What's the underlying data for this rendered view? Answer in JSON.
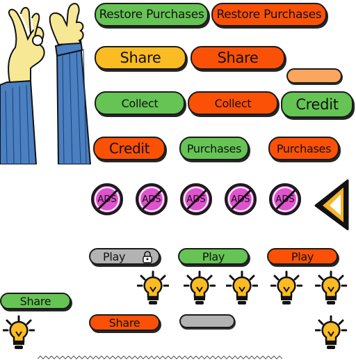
{
  "buttons": {
    "restore_green": "Restore Purchases",
    "restore_orange": "Restore Purchases",
    "share_yellow": "Share",
    "share_orange": "Share",
    "collect_green": "Collect",
    "collect_orange": "Collect",
    "credit_green": "Credit",
    "credit_orange": "Credit",
    "purchases_green": "Purchases",
    "purchases_orange": "Purchases",
    "play_grey": "Play",
    "play_green": "Play",
    "play_orange": "Play",
    "share_small_green": "Share",
    "share_small_orange": "Share"
  },
  "ads_label": "ADS",
  "icons": {
    "back": "back-arrow-icon",
    "lock": "lock-icon",
    "bulb": "lightbulb-icon",
    "hands": "ok-thumbs-up-hands-illustration"
  },
  "colors": {
    "green": "#66c455",
    "orange": "#fb5106",
    "yellow": "#fbbb22",
    "grey": "#b3b3b3",
    "ads_pink": "#e052cf",
    "sleeve_blue": "#4a7fc1",
    "skin": "#f7e896"
  }
}
